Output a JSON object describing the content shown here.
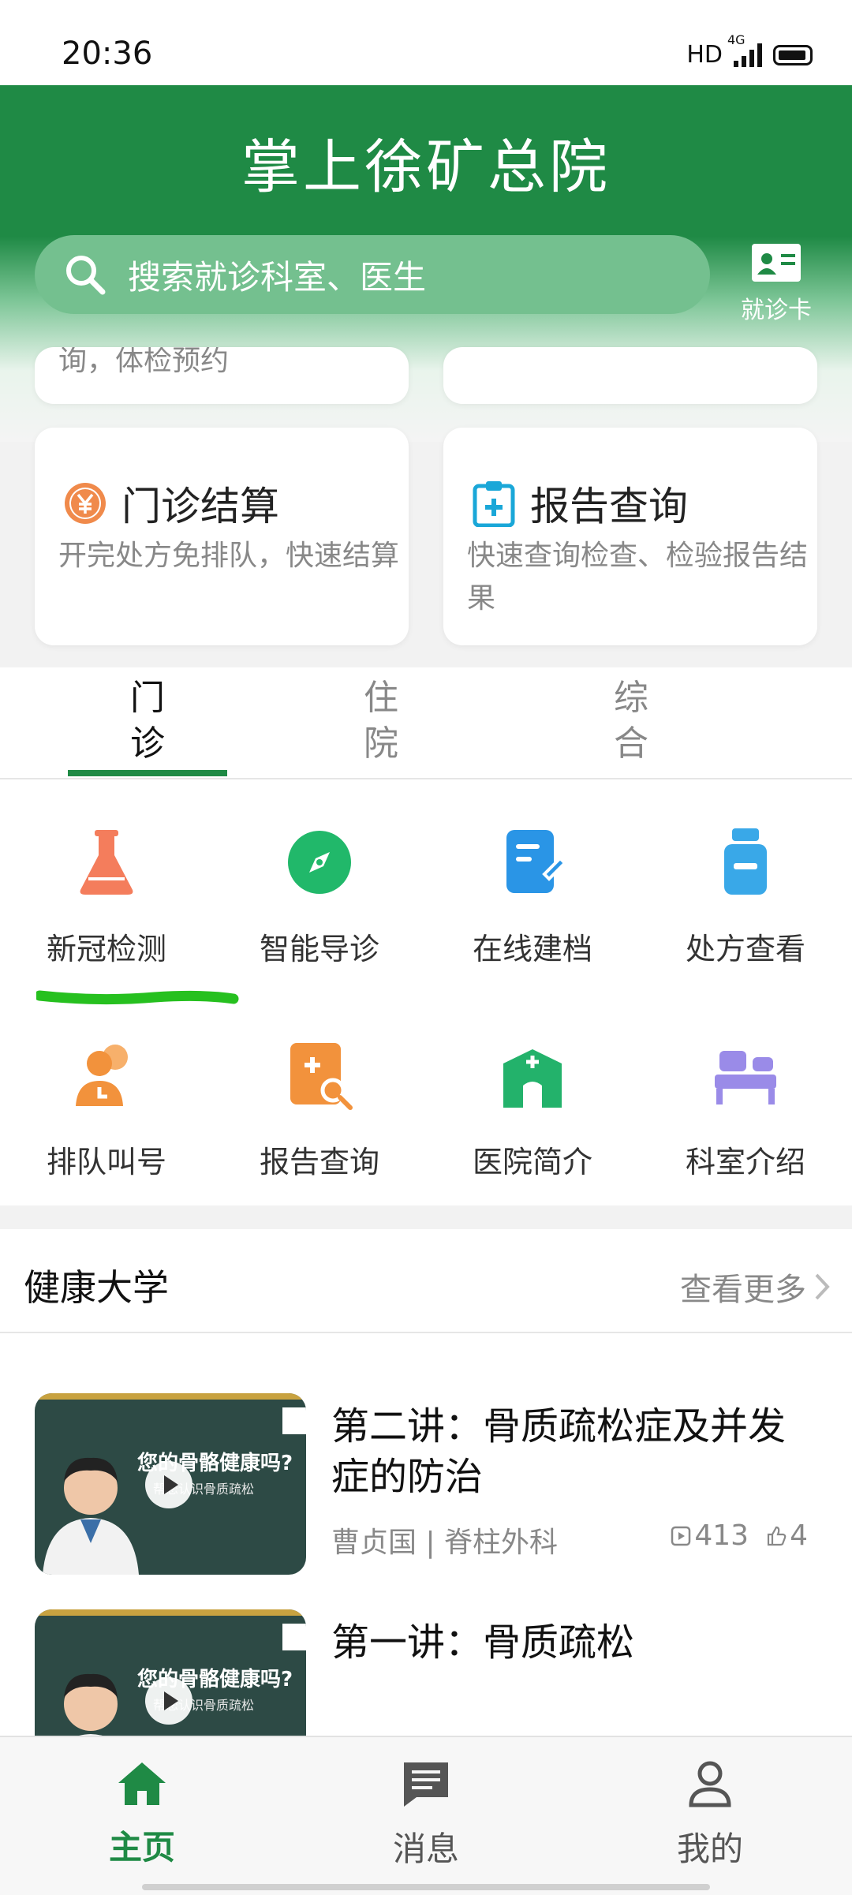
{
  "status": {
    "time": "20:36",
    "hd": "HD",
    "net": "4G"
  },
  "header": {
    "title": "掌上徐矿总院",
    "search_placeholder": "搜索就诊科室、医生",
    "card_label": "就诊卡"
  },
  "partial_cards": {
    "left_desc": "询，体检预约"
  },
  "service_cards": [
    {
      "title": "门诊结算",
      "desc": "开完处方免排队，快速结算",
      "icon": "yuan-coin-icon",
      "color": "#f08a4b"
    },
    {
      "title": "报告查询",
      "desc": "快速查询检查、检验报告结果",
      "icon": "clipboard-plus-icon",
      "color": "#1aa7d8"
    }
  ],
  "tabs": [
    {
      "label": "门诊",
      "active": true
    },
    {
      "label": "住院",
      "active": false
    },
    {
      "label": "综合",
      "active": false
    }
  ],
  "grid": [
    {
      "label": "新冠检测",
      "icon": "flask-icon",
      "color": "#f47d5c"
    },
    {
      "label": "智能导诊",
      "icon": "compass-icon",
      "color": "#21b86a"
    },
    {
      "label": "在线建档",
      "icon": "document-edit-icon",
      "color": "#2a95e6"
    },
    {
      "label": "处方查看",
      "icon": "medicine-bottle-icon",
      "color": "#39a8e8"
    },
    {
      "label": "排队叫号",
      "icon": "queue-people-icon",
      "color": "#f2923c"
    },
    {
      "label": "报告查询",
      "icon": "report-search-icon",
      "color": "#f2923c"
    },
    {
      "label": "医院简介",
      "icon": "hospital-icon",
      "color": "#23b26b"
    },
    {
      "label": "科室介绍",
      "icon": "bed-icon",
      "color": "#9a8be8"
    }
  ],
  "health": {
    "title": "健康大学",
    "more": "查看更多",
    "articles": [
      {
        "title": "第二讲：骨质疏松症及并发症的防治",
        "author": "曹贞国 | 脊柱外科",
        "views": "413",
        "likes": "4",
        "thumb_q": "您的骨骼健康吗?",
        "thumb_sub": "帮您认识骨质疏松"
      },
      {
        "title": "第一讲：骨质疏松",
        "thumb_q": "您的骨骼健康吗?",
        "thumb_sub": "帮您认识骨质疏松"
      }
    ]
  },
  "bottom_nav": [
    {
      "label": "主页",
      "icon": "home-icon",
      "active": true
    },
    {
      "label": "消息",
      "icon": "message-icon",
      "active": false
    },
    {
      "label": "我的",
      "icon": "user-icon",
      "active": false
    }
  ],
  "colors": {
    "brand_green": "#1f8a45",
    "search_bg": "#74c08f"
  }
}
